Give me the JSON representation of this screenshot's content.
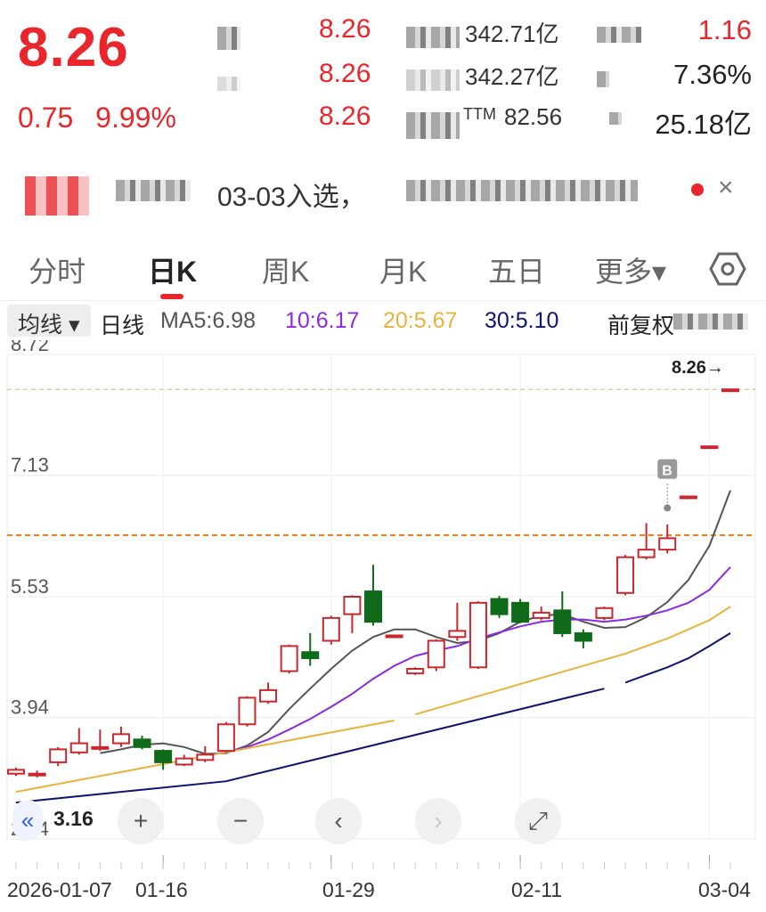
{
  "quote": {
    "price": "8.26",
    "change": "0.75",
    "change_pct": "9.99%",
    "col2": [
      "8.26",
      "8.26",
      "8.26"
    ],
    "col3": [
      "342.71亿",
      "342.27亿",
      "82.56"
    ],
    "col3_prefix": "TTM",
    "col4": [
      "1.16",
      "7.36%",
      "25.18亿"
    ]
  },
  "alert": {
    "text": "03-03入选，",
    "close": "×"
  },
  "tabs": [
    "分时",
    "日K",
    "周K",
    "月K",
    "五日",
    "更多▾"
  ],
  "active_tab": "日K",
  "ma": {
    "selector": "均线 ▾",
    "period": "日线",
    "ma5": "MA5:6.98",
    "ma10": "10:6.17",
    "ma20": "20:5.67",
    "ma30": "30:5.10",
    "adjust": "前复权",
    "colors": {
      "ma5": "#555555",
      "ma10": "#8a2be2",
      "ma20": "#e6b43c",
      "ma30": "#0f1470",
      "up": "#c8282d",
      "down": "#0f6b1a"
    }
  },
  "controls": {
    "min_label": "3.16",
    "collapse": "«",
    "zoom_in": "+",
    "zoom_out": "−",
    "prev": "‹",
    "next": "›",
    "fullscreen": "⤢"
  },
  "chart_data": {
    "type": "candlestick",
    "ylim": [
      2.34,
      8.72
    ],
    "y_ticks": [
      "8.72",
      "7.13",
      "5.53",
      "3.94",
      "2.34"
    ],
    "x_labels": [
      "2026-01-07",
      "01-16",
      "01-29",
      "02-11",
      "03-04"
    ],
    "last_price_label": "8.26→",
    "buy_marker": "B",
    "reference_line": 6.34,
    "limit_line": 8.26,
    "candles": [
      {
        "o": 3.2,
        "c": 3.25,
        "h": 3.28,
        "l": 3.17
      },
      {
        "o": 3.18,
        "c": 3.2,
        "h": 3.24,
        "l": 3.15
      },
      {
        "o": 3.35,
        "c": 3.52,
        "h": 3.55,
        "l": 3.3
      },
      {
        "o": 3.48,
        "c": 3.6,
        "h": 3.8,
        "l": 3.45
      },
      {
        "o": 3.55,
        "c": 3.55,
        "h": 3.78,
        "l": 3.5
      },
      {
        "o": 3.6,
        "c": 3.72,
        "h": 3.82,
        "l": 3.55
      },
      {
        "o": 3.65,
        "c": 3.55,
        "h": 3.7,
        "l": 3.52
      },
      {
        "o": 3.5,
        "c": 3.35,
        "h": 3.52,
        "l": 3.25
      },
      {
        "o": 3.32,
        "c": 3.4,
        "h": 3.45,
        "l": 3.3
      },
      {
        "o": 3.38,
        "c": 3.45,
        "h": 3.56,
        "l": 3.35
      },
      {
        "o": 3.5,
        "c": 3.85,
        "h": 3.88,
        "l": 3.48
      },
      {
        "o": 3.85,
        "c": 4.2,
        "h": 4.22,
        "l": 3.82
      },
      {
        "o": 4.15,
        "c": 4.3,
        "h": 4.4,
        "l": 4.12
      },
      {
        "o": 4.55,
        "c": 4.88,
        "h": 4.9,
        "l": 4.52
      },
      {
        "o": 4.8,
        "c": 4.72,
        "h": 5.05,
        "l": 4.62
      },
      {
        "o": 4.95,
        "c": 5.25,
        "h": 5.28,
        "l": 4.9
      },
      {
        "o": 5.3,
        "c": 5.53,
        "h": 5.55,
        "l": 5.05
      },
      {
        "o": 5.6,
        "c": 5.2,
        "h": 5.95,
        "l": 5.15
      },
      {
        "o": 5.02,
        "c": 5.02,
        "h": 5.02,
        "l": 5.02
      },
      {
        "o": 4.52,
        "c": 4.58,
        "h": 4.6,
        "l": 4.5
      },
      {
        "o": 4.6,
        "c": 4.95,
        "h": 4.97,
        "l": 4.55
      },
      {
        "o": 5.0,
        "c": 5.08,
        "h": 5.45,
        "l": 4.95
      },
      {
        "o": 4.6,
        "c": 5.45,
        "h": 5.47,
        "l": 4.58
      },
      {
        "o": 5.5,
        "c": 5.3,
        "h": 5.54,
        "l": 5.25
      },
      {
        "o": 5.45,
        "c": 5.2,
        "h": 5.5,
        "l": 5.18
      },
      {
        "o": 5.25,
        "c": 5.32,
        "h": 5.4,
        "l": 5.22
      },
      {
        "o": 5.35,
        "c": 5.05,
        "h": 5.6,
        "l": 5.0
      },
      {
        "o": 5.05,
        "c": 4.95,
        "h": 5.1,
        "l": 4.85
      },
      {
        "o": 5.25,
        "c": 5.38,
        "h": 5.4,
        "l": 5.22
      },
      {
        "o": 5.58,
        "c": 6.05,
        "h": 6.08,
        "l": 5.55
      },
      {
        "o": 6.05,
        "c": 6.15,
        "h": 6.5,
        "l": 6.02
      },
      {
        "o": 6.15,
        "c": 6.3,
        "h": 6.48,
        "l": 6.1
      },
      {
        "o": 6.85,
        "c": 6.85,
        "h": 6.85,
        "l": 6.85
      },
      {
        "o": 7.51,
        "c": 7.51,
        "h": 7.51,
        "l": 7.51
      },
      {
        "o": 8.26,
        "c": 8.26,
        "h": 8.26,
        "l": 8.26
      }
    ],
    "series": [
      {
        "name": "MA5",
        "values": [
          null,
          null,
          null,
          null,
          3.47,
          3.52,
          3.58,
          3.6,
          3.55,
          3.46,
          3.47,
          3.57,
          3.75,
          4.05,
          4.32,
          4.58,
          4.82,
          5.0,
          5.1,
          5.1,
          5.0,
          4.92,
          4.95,
          5.05,
          5.2,
          5.28,
          5.3,
          5.2,
          5.12,
          5.13,
          5.26,
          5.46,
          5.75,
          6.2,
          6.93
        ]
      },
      {
        "name": "MA10",
        "values": [
          null,
          null,
          null,
          null,
          null,
          null,
          null,
          null,
          null,
          3.44,
          3.48,
          3.55,
          3.65,
          3.78,
          3.92,
          4.08,
          4.25,
          4.45,
          4.62,
          4.75,
          4.82,
          4.88,
          4.98,
          5.06,
          5.14,
          5.2,
          5.23,
          5.23,
          5.2,
          5.23,
          5.28,
          5.35,
          5.45,
          5.62,
          5.92
        ]
      },
      {
        "name": "MA20",
        "values": [
          null,
          null,
          null,
          null,
          null,
          null,
          null,
          null,
          null,
          null,
          null,
          null,
          null,
          null,
          null,
          null,
          null,
          null,
          null,
          3.98,
          4.06,
          4.14,
          4.22,
          4.3,
          4.38,
          4.46,
          4.54,
          4.62,
          4.7,
          4.78,
          4.88,
          4.98,
          5.1,
          5.22,
          5.4
        ]
      },
      {
        "name": "MA30",
        "values": [
          null,
          null,
          null,
          null,
          null,
          null,
          null,
          null,
          null,
          null,
          null,
          null,
          null,
          null,
          null,
          null,
          null,
          null,
          null,
          null,
          null,
          null,
          null,
          null,
          null,
          null,
          null,
          null,
          null,
          4.4,
          4.5,
          4.6,
          4.72,
          4.88,
          5.05
        ]
      }
    ]
  }
}
